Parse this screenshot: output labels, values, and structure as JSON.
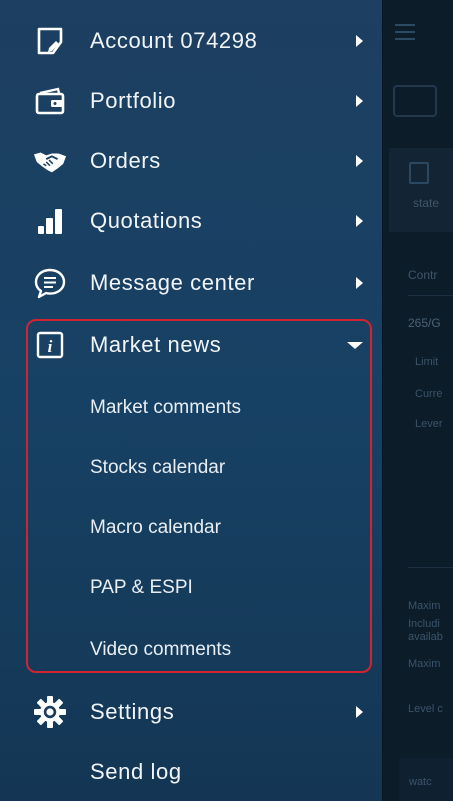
{
  "drawer": {
    "menu": [
      {
        "label": "Account 074298",
        "icon": "account-icon",
        "expandable": true
      },
      {
        "label": "Portfolio",
        "icon": "wallet-icon",
        "expandable": true
      },
      {
        "label": "Orders",
        "icon": "handshake-icon",
        "expandable": true
      },
      {
        "label": "Quotations",
        "icon": "bar-chart-icon",
        "expandable": true
      },
      {
        "label": "Message center",
        "icon": "chat-bubble-icon",
        "expandable": true
      },
      {
        "label": "Market news",
        "icon": "info-icon",
        "expanded": true
      },
      {
        "label": "Settings",
        "icon": "gear-icon",
        "expandable": true
      },
      {
        "label": "Send log",
        "icon": "",
        "expandable": false
      }
    ],
    "market_news_subitems": [
      "Market comments",
      "Stocks calendar",
      "Macro calendar",
      "PAP & ESPI",
      "Video comments"
    ],
    "highlight_color": "#d22430"
  },
  "background": {
    "card_label": "state",
    "section_label": "Contr",
    "value_label": "265/G",
    "row_labels": [
      "Limit",
      "Curre",
      "Lever"
    ],
    "lower_labels": [
      "Maxim",
      "Includi",
      "availab",
      "Maxim",
      "Level c"
    ],
    "bottom_button": "watc"
  },
  "colors": {
    "drawer_bg": "#1b4063",
    "text": "#f1f5f8",
    "main_bg": "#0c1c29"
  }
}
